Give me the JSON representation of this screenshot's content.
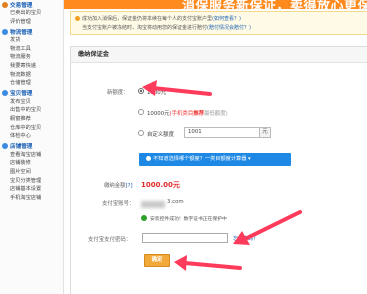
{
  "sidebar": {
    "sections": [
      {
        "title": "交易管理",
        "color": "#e08020",
        "items": [
          "已卖出的宝贝",
          "评价管理"
        ]
      },
      {
        "title": "物流管理",
        "color": "#3b8be0",
        "items": [
          "发货",
          "物流工具",
          "物流服务",
          "我要寄快递",
          "物流数据",
          "仓储管理"
        ]
      },
      {
        "title": "宝贝管理",
        "color": "#3b8be0",
        "items": [
          "发布宝贝",
          "出售中的宝贝",
          "橱窗推荐",
          "仓库中的宝贝",
          "体检中心"
        ]
      },
      {
        "title": "店铺管理",
        "color": "#3b8be0",
        "items": [
          "查看淘宝店铺",
          "店铺装修",
          "图片空间",
          "宝贝分类管理",
          "店铺基本设置",
          "手机淘宝店铺"
        ]
      }
    ]
  },
  "banner": {
    "text": "消保服务新保证，卖得放心更保证"
  },
  "notice": {
    "line1_text": "成功加入消保后，保证金仍将本续在每个人的支付宝账户里",
    "line1_link": "(如何查看？)",
    "line2_text": "当支付宝账户被冻结时，淘宝将动用您的保证金进行赔付",
    "line2_link": "(赔付情况会赔付？)"
  },
  "panel": {
    "title": "缴纳保证金",
    "amount_label": "新额度：",
    "options": [
      {
        "value": "1000元",
        "selected": true
      },
      {
        "value": "10000元",
        "tag": "(手机类目",
        "recommend": "推荐",
        "note": "最低额度)",
        "selected": false
      },
      {
        "value": "自定义额度",
        "input": "1001",
        "unit": "元",
        "selected": false
      }
    ],
    "calc_bar": "不知道选择哪个额度？一类目额度计算器",
    "deposit_label": "缴纳金额",
    "deposit_help": "[?]",
    "deposit_value": "1000.00元",
    "account_label": "支付宝账号：",
    "account_value": "3.com",
    "status_text": "安装控件成功！数字证书正在保护中",
    "password_label": "支付宝支付密码：",
    "password_value": "",
    "forgot_link": "忘记密码？",
    "confirm_button": "确定"
  },
  "colors": {
    "banner": "#ff8a1e",
    "button": "#f2a93a",
    "calc_bar": "#1e88e5",
    "amount": "#e3292b",
    "arrows": "#ff3b5c"
  }
}
